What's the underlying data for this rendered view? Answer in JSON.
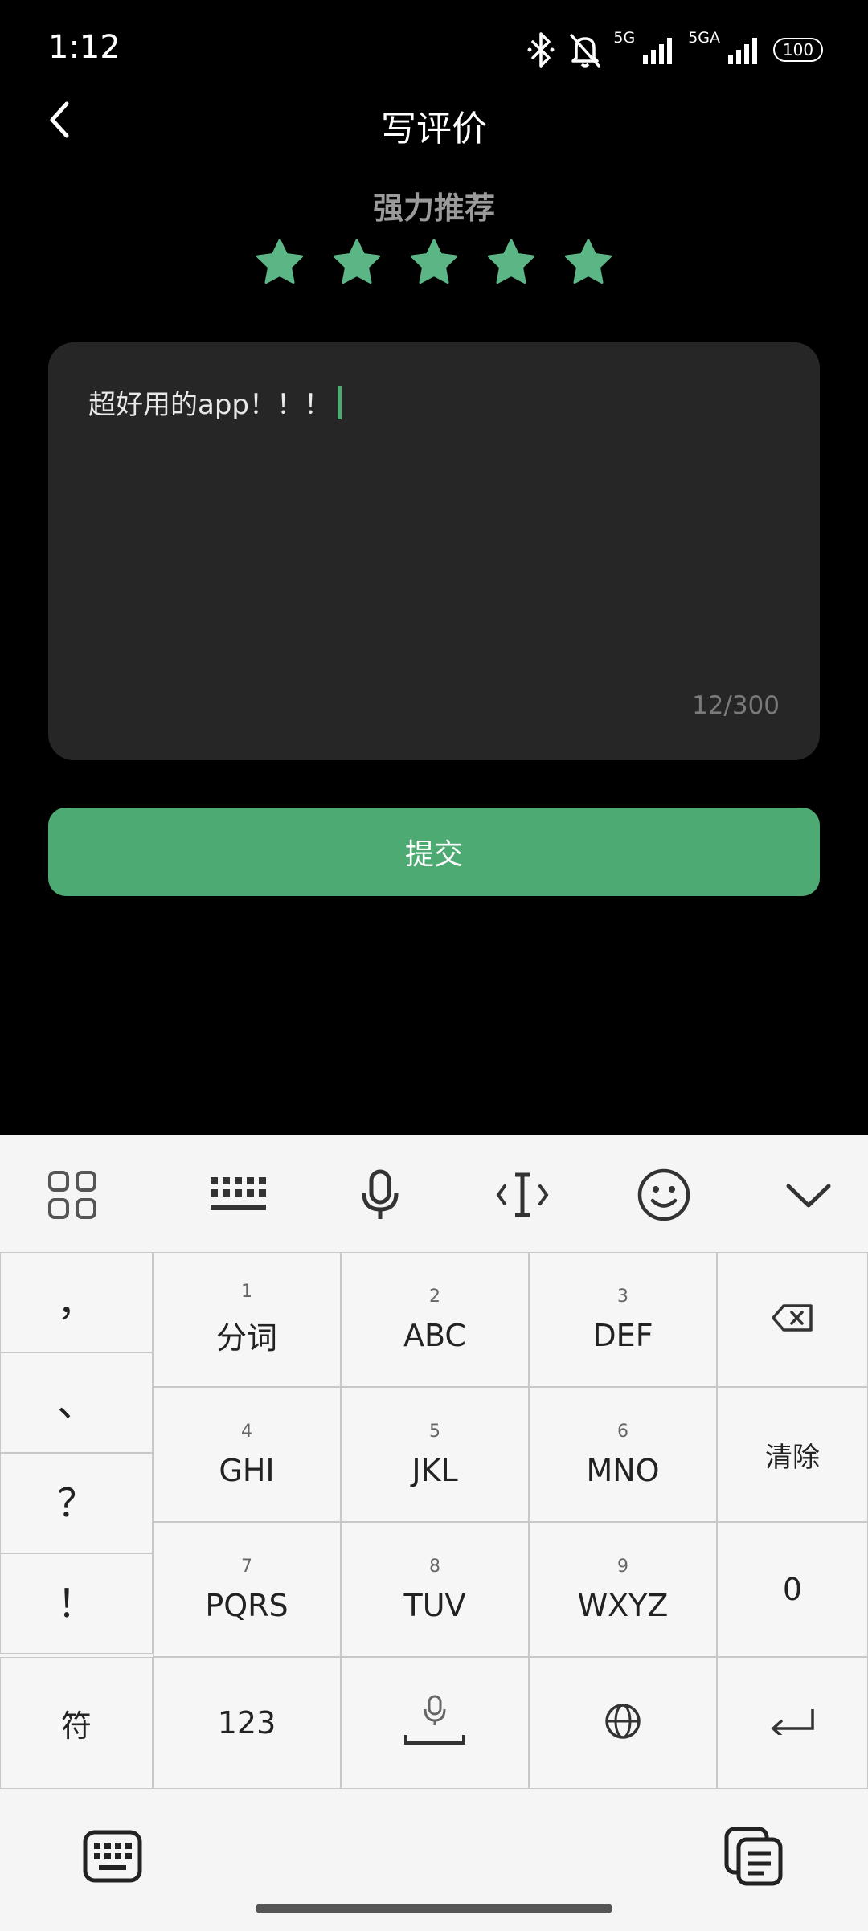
{
  "status_bar": {
    "time": "1:12",
    "network_1": "5G",
    "network_2": "5GA",
    "battery": "100",
    "icons": [
      "bluetooth-icon",
      "bell-off-icon",
      "signal-icon",
      "signal-icon",
      "battery-icon"
    ]
  },
  "header": {
    "title": "写评价",
    "back_icon": "chevron-left-icon"
  },
  "rating": {
    "label": "强力推荐",
    "value": 5,
    "max": 5,
    "star_color": "#5bb585"
  },
  "review": {
    "text": "超好用的app！！！",
    "char_count": "12/300",
    "caret_color": "#4eaa73"
  },
  "submit": {
    "label": "提交",
    "color": "#4eaa73"
  },
  "keyboard": {
    "toolbar": [
      "apps-icon",
      "keyboard-icon",
      "microphone-icon",
      "cursor-icon",
      "emoji-icon",
      "chevron-down-icon"
    ],
    "punctuation": [
      "，",
      "、",
      "？",
      "！"
    ],
    "keys": [
      {
        "num": "1",
        "label": "分词"
      },
      {
        "num": "2",
        "label": "ABC"
      },
      {
        "num": "3",
        "label": "DEF"
      },
      {
        "num": "4",
        "label": "GHI"
      },
      {
        "num": "5",
        "label": "JKL"
      },
      {
        "num": "6",
        "label": "MNO"
      },
      {
        "num": "7",
        "label": "PQRS"
      },
      {
        "num": "8",
        "label": "TUV"
      },
      {
        "num": "9",
        "label": "WXYZ"
      }
    ],
    "clear_label": "清除",
    "zero_label": "0",
    "symbols_label": "符",
    "numbers_label": "123"
  },
  "bottom_bar": {
    "icons": [
      "keyboard-switch-icon",
      "clipboard-icon"
    ]
  }
}
